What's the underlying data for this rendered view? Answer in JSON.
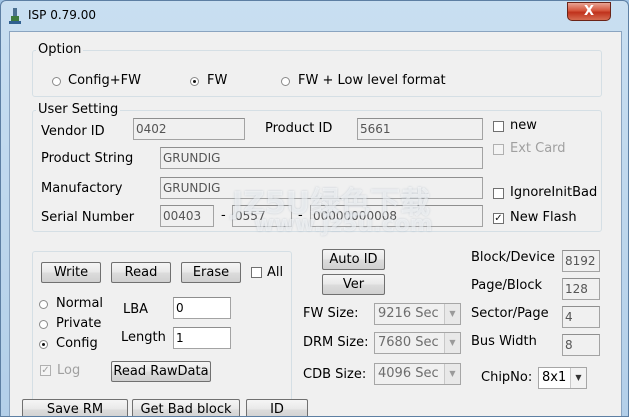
{
  "window": {
    "title": "ISP 0.79.00",
    "close_label": "X"
  },
  "option": {
    "title": "Option",
    "radios": [
      {
        "label": "Config+FW",
        "selected": false
      },
      {
        "label": "FW",
        "selected": true
      },
      {
        "label": "FW + Low level format",
        "selected": false
      }
    ]
  },
  "user_setting": {
    "title": "User Setting",
    "vendor_id_label": "Vendor ID",
    "vendor_id": "0402",
    "product_id_label": "Product ID",
    "product_id": "5661",
    "product_string_label": "Product String",
    "product_string": "GRUNDIG",
    "manufactory_label": "Manufactory",
    "manufactory": "GRUNDIG",
    "serial_number_label": "Serial Number",
    "serial_part1": "00403",
    "serial_sep1": "-",
    "serial_part2": "0557",
    "serial_sep2": "-",
    "serial_part3": "00000000008",
    "new_label": "new",
    "new_checked": false,
    "ext_card_label": "Ext Card",
    "ext_card_checked": false,
    "ignore_init_bad_label": "IgnoreInitBad",
    "ignore_init_bad_checked": false,
    "new_flash_label": "New Flash",
    "new_flash_checked": true
  },
  "rw_panel": {
    "write_label": "Write",
    "read_label": "Read",
    "erase_label": "Erase",
    "all_label": "All",
    "all_checked": false,
    "mode_radios": [
      {
        "label": "Normal",
        "selected": false
      },
      {
        "label": "Private",
        "selected": false
      },
      {
        "label": "Config",
        "selected": true
      }
    ],
    "lba_label": "LBA",
    "lba_value": "0",
    "length_label": "Length",
    "length_value": "1",
    "log_label": "Log",
    "log_checked": true,
    "read_rawdata_label": "Read RawData"
  },
  "center": {
    "auto_id_label": "Auto ID",
    "ver_label": "Ver",
    "fw_size_label": "FW Size:",
    "fw_size_value": "9216 Sec",
    "drm_size_label": "DRM Size:",
    "drm_size_value": "7680 Sec",
    "cdb_size_label": "CDB Size:",
    "cdb_size_value": "4096 Sec"
  },
  "right": {
    "block_device_label": "Block/Device",
    "block_device_value": "8192",
    "page_block_label": "Page/Block",
    "page_block_value": "128",
    "sector_page_label": "Sector/Page",
    "sector_page_value": "4",
    "bus_width_label": "Bus Width",
    "bus_width_value": "8",
    "chipno_label": "ChipNo:",
    "chipno_value": "8x1"
  },
  "bottom_buttons": {
    "save_rm_label": "Save RM",
    "get_bad_block_label": "Get Bad block",
    "id_label": "ID"
  },
  "watermark": {
    "line1": "JZ5U绿色下载",
    "line2": "www.jz5u.com"
  }
}
